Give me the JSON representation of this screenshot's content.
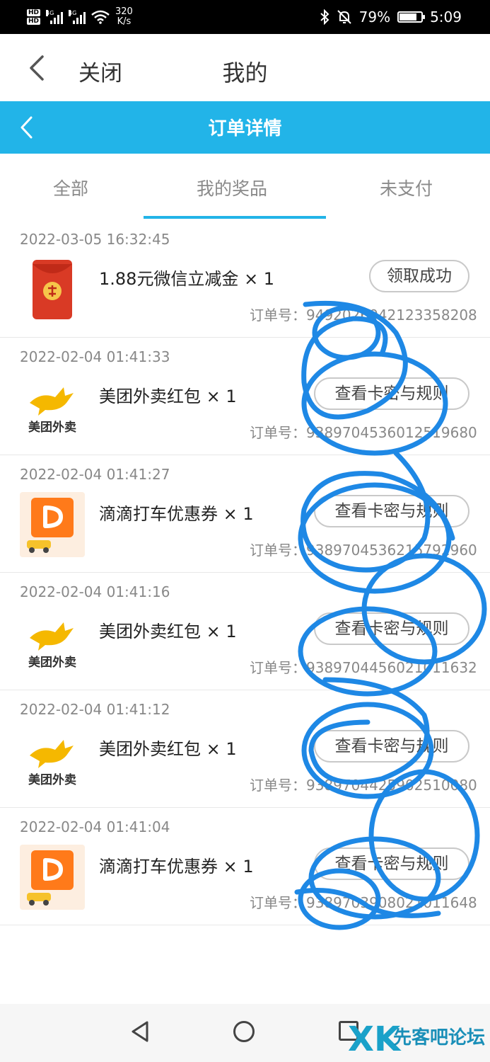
{
  "status_bar": {
    "hd1": "HD",
    "hd2": "HD",
    "net1": "4G",
    "net2": "4G",
    "speed_value": "320",
    "speed_unit": "K/s",
    "battery": "79%",
    "battery_level": 0.79,
    "time": "5:09"
  },
  "titlebar": {
    "close_label": "关闭",
    "title": "我的"
  },
  "order_header": {
    "title": "订单详情"
  },
  "tabs": [
    {
      "label": "全部"
    },
    {
      "label": "我的奖品",
      "active": true
    },
    {
      "label": "未支付"
    }
  ],
  "orders": [
    {
      "date": "2022-03-05 16:32:45",
      "name": "1.88元微信立减金 × 1",
      "button": "领取成功",
      "order_no": "订单号：9492026042123358208",
      "thumb": "wechat-red-envelope-icon"
    },
    {
      "date": "2022-02-04 01:41:33",
      "name": "美团外卖红包 × 1",
      "button": "查看卡密与规则",
      "order_no": "订单号：9389704536012519680",
      "thumb": "meituan-waimai-logo"
    },
    {
      "date": "2022-02-04 01:41:27",
      "name": "滴滴打车优惠券 × 1",
      "button": "查看卡密与规则",
      "order_no": "订单号：9389704536215792960",
      "thumb": "didi-coupon-logo"
    },
    {
      "date": "2022-02-04 01:41:16",
      "name": "美团外卖红包 × 1",
      "button": "查看卡密与规则",
      "order_no": "订单号：9389704456021011632",
      "thumb": "meituan-waimai-logo"
    },
    {
      "date": "2022-02-04 01:41:12",
      "name": "美团外卖红包 × 1",
      "button": "查看卡密与规则",
      "order_no": "订单号：9389704425902510080",
      "thumb": "meituan-waimai-logo"
    },
    {
      "date": "2022-02-04 01:41:04",
      "name": "滴滴打车优惠券 × 1",
      "button": "查看卡密与规则",
      "order_no": "订单号：9389703908021011648",
      "thumb": "didi-coupon-logo"
    }
  ],
  "watermark": {
    "text": "先客吧论坛",
    "logo": "XK"
  },
  "colors": {
    "accent": "#22b4e8",
    "scribble": "#1e88e5",
    "meituan_yellow": "#f5b800",
    "didi_orange": "#ff7a1a",
    "envelope_red": "#d93a25"
  }
}
